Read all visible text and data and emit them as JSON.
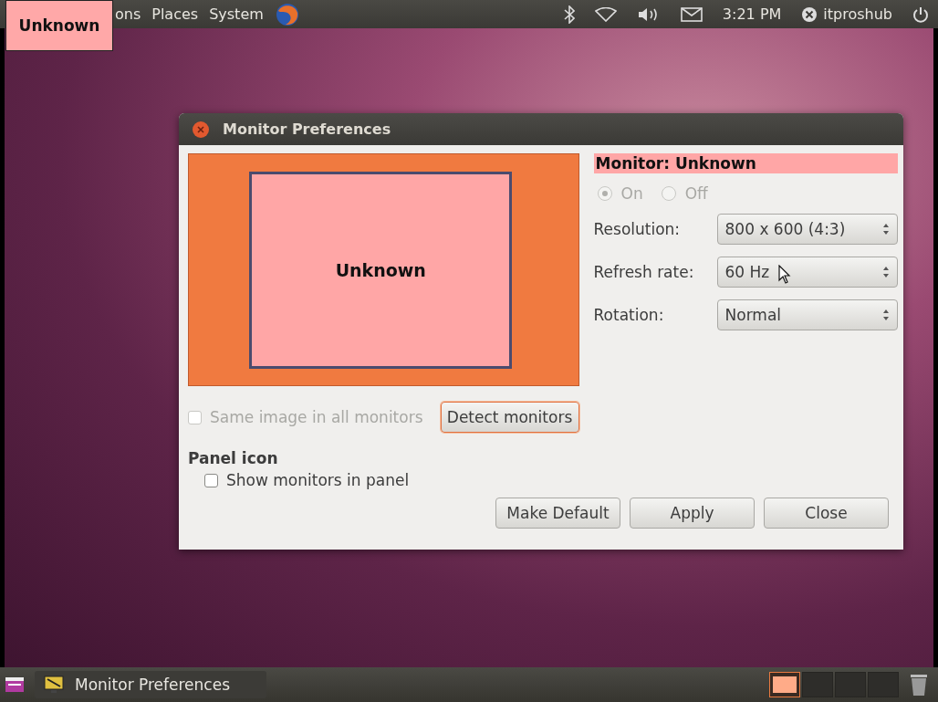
{
  "top_panel": {
    "menus": [
      "ons",
      "Places",
      "System"
    ],
    "clock": "3:21 PM",
    "user": "itproshub"
  },
  "monitor_label": {
    "text": "Unknown"
  },
  "dialog": {
    "title": "Monitor Preferences",
    "preview_label": "Unknown",
    "monitor_heading": "Monitor: Unknown",
    "power": {
      "disabled": true,
      "options": [
        {
          "label": "On",
          "selected": true
        },
        {
          "label": "Off",
          "selected": false
        }
      ]
    },
    "settings": [
      {
        "label": "Resolution:",
        "value": "800 x 600 (4:3)"
      },
      {
        "label": "Refresh rate:",
        "value": "60 Hz"
      },
      {
        "label": "Rotation:",
        "value": "Normal"
      }
    ],
    "same_image": {
      "label": "Same image in all monitors",
      "checked": false,
      "disabled": true
    },
    "detect_button": "Detect monitors",
    "panel_icon": {
      "heading": "Panel icon",
      "label": "Show monitors in panel",
      "checked": false
    },
    "buttons": [
      "Make Default",
      "Apply",
      "Close"
    ]
  },
  "taskbar": {
    "items": [
      {
        "label": "Monitor Preferences"
      }
    ],
    "workspaces": [
      {
        "selected": true
      },
      {
        "selected": false
      },
      {
        "selected": false
      },
      {
        "selected": false
      }
    ]
  }
}
